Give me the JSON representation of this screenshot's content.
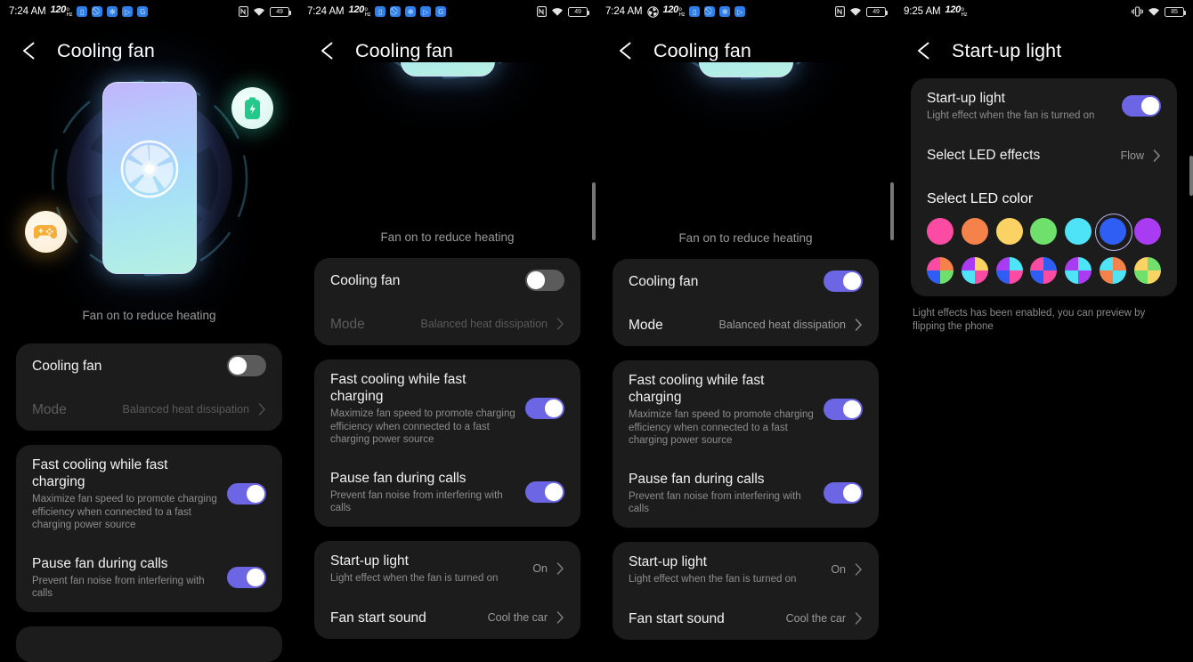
{
  "panels": [
    {
      "statusbar": {
        "time": "7:24 AM",
        "refresh_rate": "120",
        "refresh_unit_top": "o",
        "refresh_unit_bottom": "Hz",
        "app_icons": [
          "sim-icon",
          "no-sound-icon",
          "gear-icon",
          "play-icon",
          "google-icon"
        ],
        "has_fan_icon": false,
        "nfc": "nfc-icon",
        "wifi": "wifi-icon",
        "battery": "49"
      },
      "appbar": {
        "back": "back-arrow-icon",
        "title": "Cooling fan"
      },
      "hero": {
        "caption": "Fan on to reduce heating",
        "badge_battery": "battery-bolt-icon",
        "badge_game": "gamepad-icon"
      },
      "cards": [
        {
          "rows": [
            {
              "type": "toggle",
              "title": "Cooling fan",
              "on": false,
              "dim": false
            },
            {
              "type": "nav",
              "title": "Mode",
              "value": "Balanced heat dissipation",
              "dim": true
            }
          ]
        },
        {
          "rows": [
            {
              "type": "toggle",
              "title": "Fast cooling while fast charging",
              "sub": "Maximize fan speed to promote charging efficiency when connected to a fast charging power source",
              "on": true
            },
            {
              "type": "toggle",
              "title": "Pause fan during calls",
              "sub": "Prevent fan noise from interfering with calls",
              "on": true
            }
          ]
        },
        {
          "rows": []
        }
      ]
    },
    {
      "statusbar": {
        "time": "7:24 AM",
        "refresh_rate": "120",
        "refresh_unit_top": "o",
        "refresh_unit_bottom": "Hz",
        "app_icons": [
          "sim-icon",
          "no-sound-icon",
          "gear-icon",
          "play-icon",
          "google-icon"
        ],
        "has_fan_icon": false,
        "nfc": "nfc-icon",
        "wifi": "wifi-icon",
        "battery": "49"
      },
      "appbar": {
        "back": "back-arrow-icon",
        "title": "Cooling fan"
      },
      "hero": {
        "caption": "Fan on to reduce heating",
        "badge_game": "gamepad-icon"
      },
      "cards": [
        {
          "rows": [
            {
              "type": "toggle",
              "title": "Cooling fan",
              "on": false,
              "dim": false
            },
            {
              "type": "nav",
              "title": "Mode",
              "value": "Balanced heat dissipation",
              "dim": true
            }
          ]
        },
        {
          "rows": [
            {
              "type": "toggle",
              "title": "Fast cooling while fast charging",
              "sub": "Maximize fan speed to promote charging efficiency when connected to a fast charging power source",
              "on": true
            },
            {
              "type": "toggle",
              "title": "Pause fan during calls",
              "sub": "Prevent fan noise from interfering with calls",
              "on": true
            }
          ]
        },
        {
          "rows": [
            {
              "type": "nav",
              "title": "Start-up light",
              "sub": "Light effect when the fan is turned on",
              "value": "On"
            },
            {
              "type": "nav",
              "title": "Fan start sound",
              "value": "Cool the car"
            }
          ]
        }
      ]
    },
    {
      "statusbar": {
        "time": "7:24 AM",
        "refresh_rate": "120",
        "refresh_unit_top": "o",
        "refresh_unit_bottom": "Hz",
        "app_icons": [
          "sim-icon",
          "no-sound-icon",
          "gear-icon",
          "play-icon"
        ],
        "has_fan_icon": true,
        "nfc": "nfc-icon",
        "wifi": "wifi-icon",
        "battery": "49"
      },
      "appbar": {
        "back": "back-arrow-icon",
        "title": "Cooling fan"
      },
      "hero": {
        "caption": "Fan on to reduce heating",
        "badge_game": "gamepad-icon"
      },
      "cards": [
        {
          "rows": [
            {
              "type": "toggle",
              "title": "Cooling fan",
              "on": true,
              "dim": false
            },
            {
              "type": "nav",
              "title": "Mode",
              "value": "Balanced heat dissipation",
              "dim": false
            }
          ]
        },
        {
          "rows": [
            {
              "type": "toggle",
              "title": "Fast cooling while fast charging",
              "sub": "Maximize fan speed to promote charging efficiency when connected to a fast charging power source",
              "on": true
            },
            {
              "type": "toggle",
              "title": "Pause fan during calls",
              "sub": "Prevent fan noise from interfering with calls",
              "on": true
            }
          ]
        },
        {
          "rows": [
            {
              "type": "nav",
              "title": "Start-up light",
              "sub": "Light effect when the fan is turned on",
              "value": "On"
            },
            {
              "type": "nav",
              "title": "Fan start sound",
              "value": "Cool the car"
            }
          ]
        }
      ]
    },
    {
      "statusbar": {
        "time": "9:25 AM",
        "refresh_rate": "120",
        "refresh_unit_top": "o",
        "refresh_unit_bottom": "Hz",
        "app_icons": [],
        "has_fan_icon": false,
        "vibrate": "vibrate-icon",
        "wifi": "wifi-icon",
        "battery": "85"
      },
      "appbar": {
        "back": "back-arrow-icon",
        "title": "Start-up light"
      },
      "led": {
        "toggle_row": {
          "title": "Start-up light",
          "sub": "Light effect when the fan is turned on",
          "on": true
        },
        "effects_row": {
          "title": "Select LED effects",
          "value": "Flow"
        },
        "color_section_title": "Select LED color",
        "note": "Light effects has been enabled, you can preview by flipping the phone",
        "solid_colors": [
          {
            "name": "pink",
            "hex": "#fb4ba3",
            "selected": false
          },
          {
            "name": "orange",
            "hex": "#f4824a",
            "selected": false
          },
          {
            "name": "yellow",
            "hex": "#fbd365",
            "selected": false
          },
          {
            "name": "green",
            "hex": "#6fe06b",
            "selected": false
          },
          {
            "name": "cyan",
            "hex": "#4fe3f7",
            "selected": false
          },
          {
            "name": "blue",
            "hex": "#2f5ef5",
            "selected": true
          },
          {
            "name": "purple",
            "hex": "#a93cf2",
            "selected": false
          }
        ],
        "multi_colors": [
          {
            "name": "multi-1",
            "quads": [
              "#fb4ba3",
              "#f4824a",
              "#6fe06b",
              "#2f5ef5"
            ]
          },
          {
            "name": "multi-2",
            "quads": [
              "#a93cf2",
              "#fbd365",
              "#fb4ba3",
              "#4fe3f7"
            ]
          },
          {
            "name": "multi-3",
            "quads": [
              "#a93cf2",
              "#4fe3f7",
              "#fb4ba3",
              "#2f5ef5"
            ]
          },
          {
            "name": "multi-4",
            "quads": [
              "#fb4ba3",
              "#2f5ef5",
              "#fb4ba3",
              "#2f5ef5"
            ]
          },
          {
            "name": "multi-5",
            "quads": [
              "#a93cf2",
              "#4fe3f7",
              "#a93cf2",
              "#4fe3f7"
            ]
          },
          {
            "name": "multi-6",
            "quads": [
              "#4fe3f7",
              "#f4824a",
              "#4fe3f7",
              "#f4824a"
            ]
          },
          {
            "name": "multi-7",
            "quads": [
              "#fbd365",
              "#6fe06b",
              "#fbd365",
              "#6fe06b"
            ]
          }
        ]
      }
    }
  ],
  "theme": {
    "accent_on": "#6c66e4",
    "toggle_off": "#5b5b5b",
    "card_bg": "#1c1c1c",
    "page_bg": "#000000"
  }
}
